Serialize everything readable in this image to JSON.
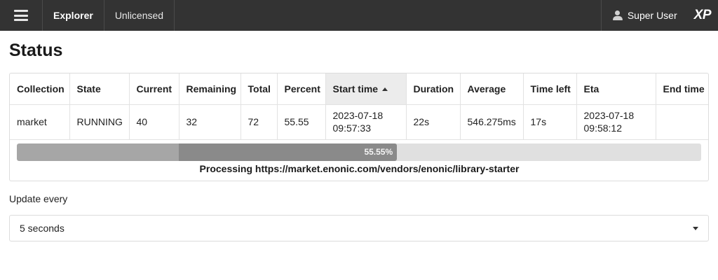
{
  "topbar": {
    "menu_icon": "hamburger-icon",
    "app_name": "Explorer",
    "license": "Unlicensed",
    "user_icon": "user-icon",
    "user_name": "Super User",
    "logo": "XP"
  },
  "page": {
    "title": "Status"
  },
  "table": {
    "headers": [
      "Collection",
      "State",
      "Current",
      "Remaining",
      "Total",
      "Percent",
      "Start time",
      "Duration",
      "Average",
      "Time left",
      "Eta",
      "End time"
    ],
    "sorted_column": "Start time",
    "sort_direction": "ascending",
    "row": {
      "collection": "market",
      "state": "RUNNING",
      "current": "40",
      "remaining": "32",
      "total": "72",
      "percent": "55.55",
      "start_date": "2023-07-18",
      "start_clock": "09:57:33",
      "duration": "22s",
      "average": "546.275ms",
      "time_left": "17s",
      "eta_date": "2023-07-18",
      "eta_clock": "09:58:12",
      "end_time": ""
    }
  },
  "progress": {
    "label": "55.55%",
    "percent": 55.55,
    "processing": "Processing https://market.enonic.com/vendors/enonic/library-starter"
  },
  "update": {
    "label": "Update every",
    "selected": "5 seconds"
  },
  "colors": {
    "topbar_bg": "#333333",
    "progress_track": "#e0e0e0",
    "progress_fill": "#8a8a8a",
    "progress_fill_light": "#a6a6a6"
  }
}
